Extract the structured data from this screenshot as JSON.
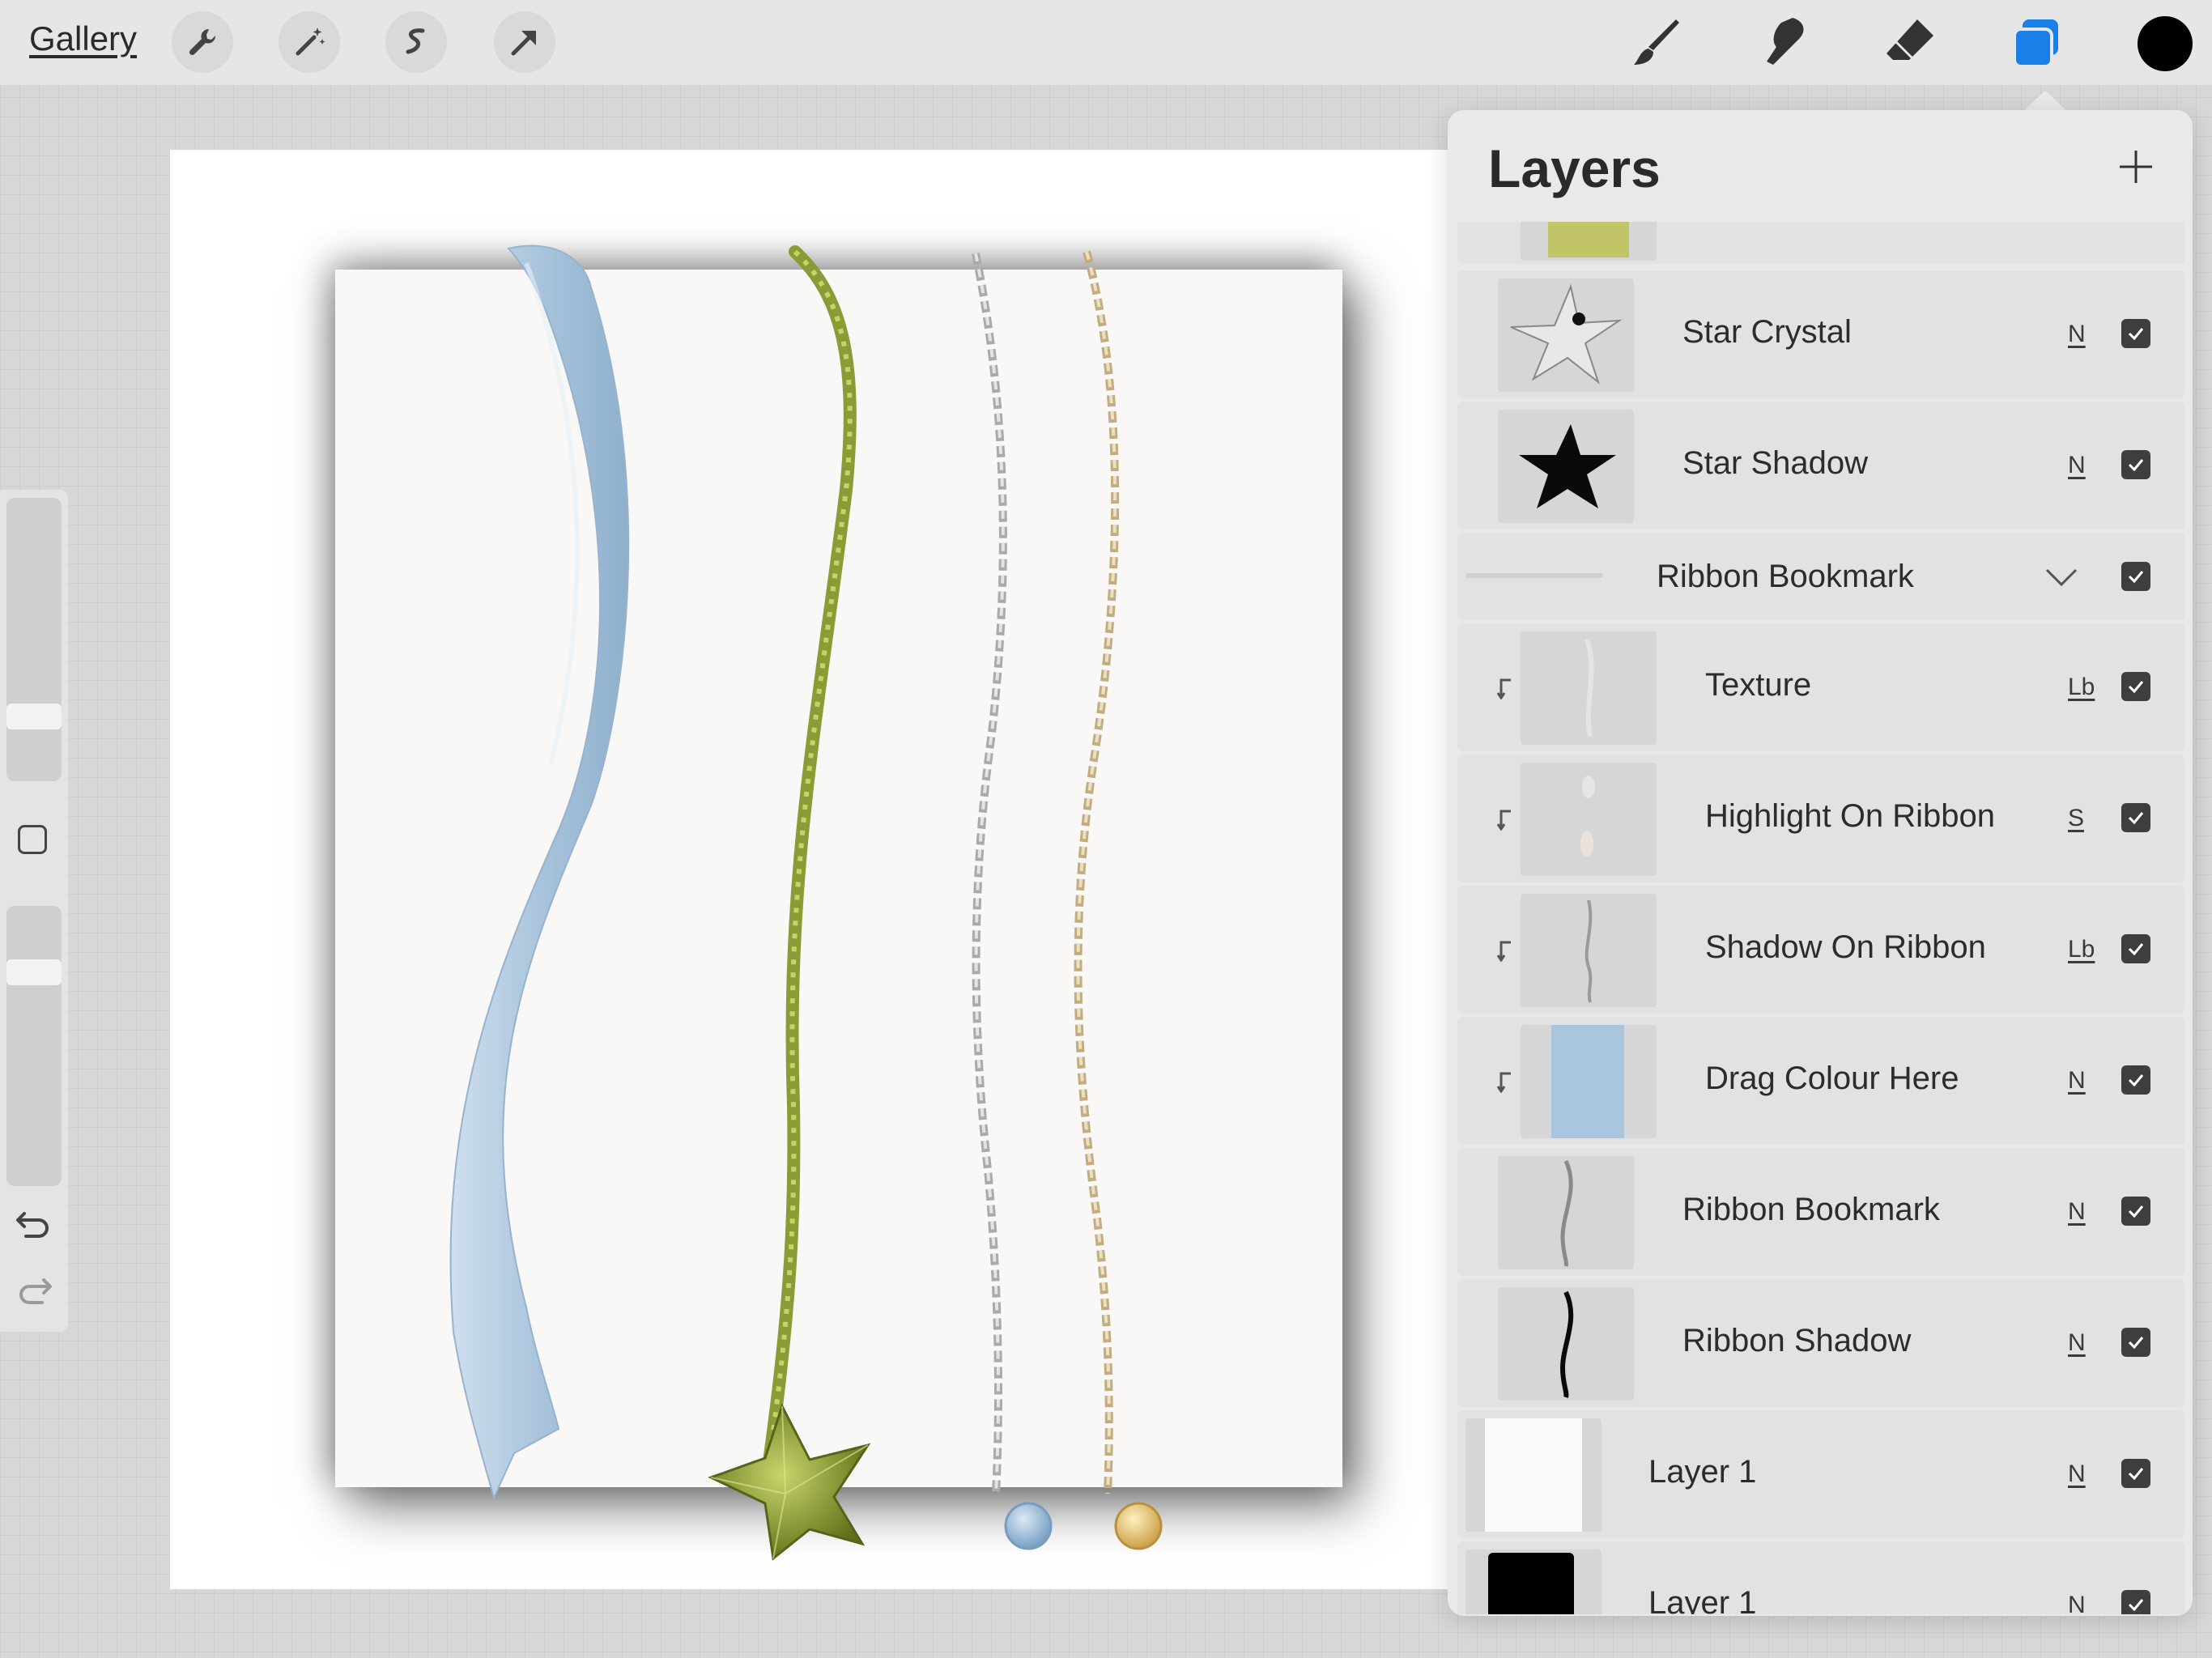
{
  "toolbar": {
    "gallery_label": "Gallery",
    "left_tools": [
      "wrench-icon",
      "magic-wand-icon",
      "selection-icon",
      "transform-arrow-icon"
    ],
    "right_tools": [
      "brush-icon",
      "smudge-icon",
      "eraser-icon",
      "layers-icon"
    ],
    "active_tool": "layers-icon",
    "current_color": "#000000",
    "accent_color": "#1a7fe6"
  },
  "sidebar": {
    "brush_size_level": 0.2,
    "opacity_level": 0.4,
    "modify_button_icon": "square-icon",
    "undo_icon": "undo-icon",
    "redo_icon": "redo-icon"
  },
  "layers_panel": {
    "title": "Layers",
    "add_icon": "plus-icon",
    "layers": [
      {
        "name": "",
        "kind": "partial",
        "thumb": "green-swatch"
      },
      {
        "name": "Star Crystal",
        "blend": "N",
        "visible": true,
        "thumb": "star-crystal"
      },
      {
        "name": "Star Shadow",
        "blend": "N",
        "visible": true,
        "thumb": "star-shadow"
      },
      {
        "name": "Ribbon Bookmark",
        "kind": "group",
        "visible": true,
        "expanded": true
      },
      {
        "name": "Texture",
        "blend": "Lb",
        "visible": true,
        "clipped": true,
        "thumb": "texture"
      },
      {
        "name": "Highlight On Ribbon",
        "blend": "S",
        "visible": true,
        "clipped": true,
        "thumb": "highlight"
      },
      {
        "name": "Shadow On Ribbon",
        "blend": "Lb",
        "visible": true,
        "clipped": true,
        "thumb": "ribbon-shadow-soft"
      },
      {
        "name": "Drag Colour Here",
        "blend": "N",
        "visible": true,
        "clipped": true,
        "thumb": "blue-swatch"
      },
      {
        "name": "Ribbon Bookmark",
        "blend": "N",
        "visible": true,
        "thumb": "ribbon-outline"
      },
      {
        "name": "Ribbon Shadow",
        "blend": "N",
        "visible": true,
        "thumb": "ribbon-black"
      },
      {
        "name": "Layer 1",
        "blend": "N",
        "visible": true,
        "thumb": "white-page"
      },
      {
        "name": "Layer 1",
        "blend": "N",
        "visible": true,
        "thumb": "black-page"
      }
    ]
  },
  "colors": {
    "ribbon_blue": "#a9c4dc",
    "cord_green": "#a3b548",
    "star_green": "#7d8f2a",
    "silver_chain": "#b8b8b8",
    "gold_chain": "#c8b488",
    "drag_colour_swatch": "#a9c6df",
    "green_swatch": "#c2c468"
  }
}
